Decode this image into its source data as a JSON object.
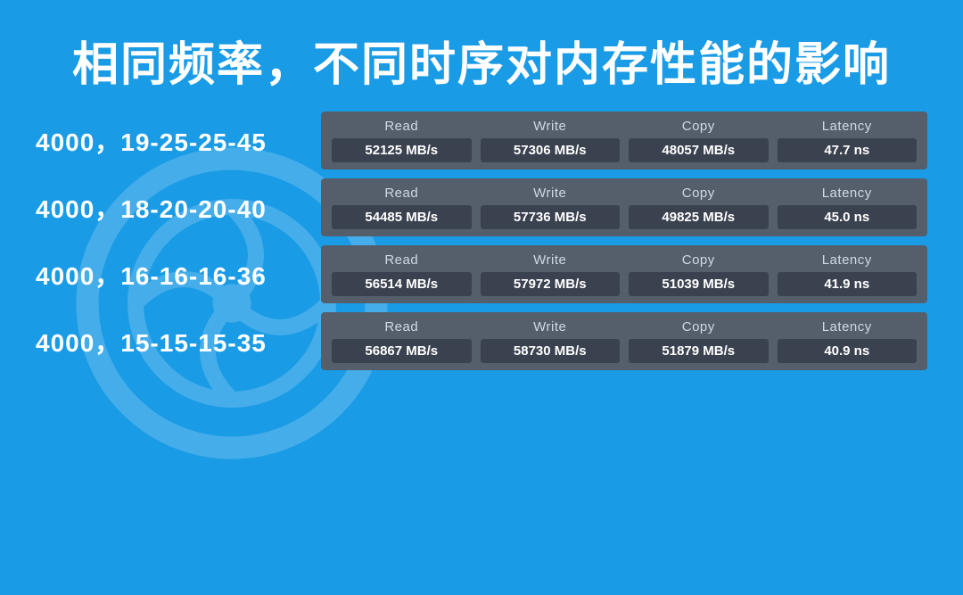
{
  "title": "相同频率，不同时序对内存性能的影响",
  "rows": [
    {
      "label": "4000，19-25-25-45",
      "cols": [
        {
          "header": "Read",
          "value": "52125 MB/s"
        },
        {
          "header": "Write",
          "value": "57306 MB/s"
        },
        {
          "header": "Copy",
          "value": "48057 MB/s"
        },
        {
          "header": "Latency",
          "value": "47.7 ns"
        }
      ]
    },
    {
      "label": "4000，18-20-20-40",
      "cols": [
        {
          "header": "Read",
          "value": "54485 MB/s"
        },
        {
          "header": "Write",
          "value": "57736 MB/s"
        },
        {
          "header": "Copy",
          "value": "49825 MB/s"
        },
        {
          "header": "Latency",
          "value": "45.0 ns"
        }
      ]
    },
    {
      "label": "4000，16-16-16-36",
      "cols": [
        {
          "header": "Read",
          "value": "56514 MB/s"
        },
        {
          "header": "Write",
          "value": "57972 MB/s"
        },
        {
          "header": "Copy",
          "value": "51039 MB/s"
        },
        {
          "header": "Latency",
          "value": "41.9 ns"
        }
      ]
    },
    {
      "label": "4000，15-15-15-35",
      "cols": [
        {
          "header": "Read",
          "value": "56867 MB/s"
        },
        {
          "header": "Write",
          "value": "58730 MB/s"
        },
        {
          "header": "Copy",
          "value": "51879 MB/s"
        },
        {
          "header": "Latency",
          "value": "40.9 ns"
        }
      ]
    }
  ]
}
